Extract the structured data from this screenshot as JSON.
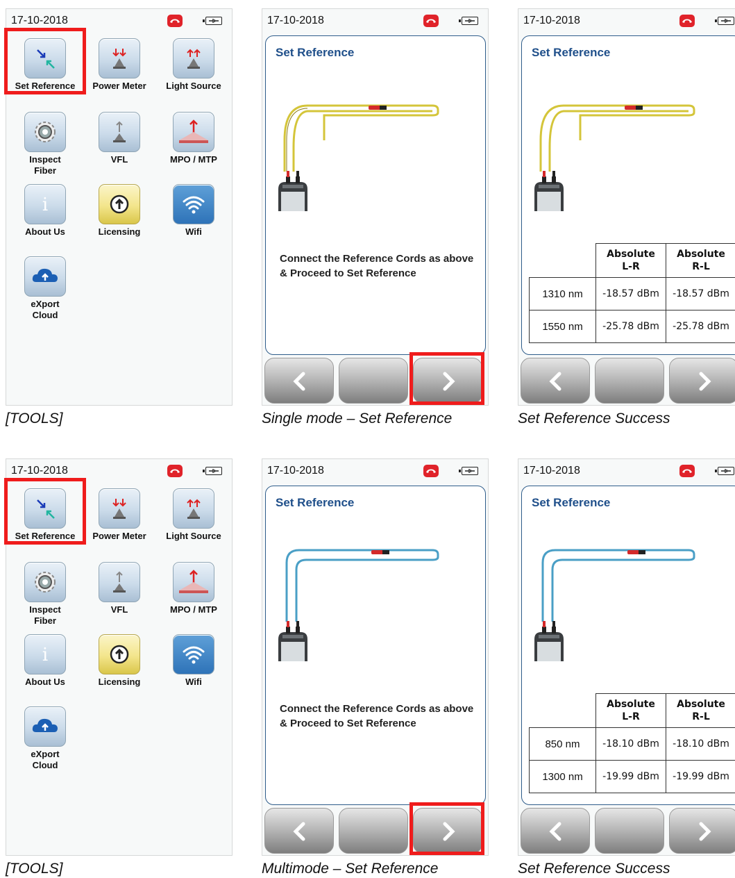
{
  "status": {
    "date": "17-10-2018"
  },
  "tools": {
    "tiles": [
      {
        "label": "Set Reference",
        "icon": "set-reference-icon"
      },
      {
        "label": "Power Meter",
        "icon": "power-meter-icon"
      },
      {
        "label": "Light Source",
        "icon": "light-source-icon"
      },
      {
        "label": "Inspect\nFiber",
        "icon": "inspect-fiber-icon"
      },
      {
        "label": "VFL",
        "icon": "vfl-icon"
      },
      {
        "label": "MPO / MTP",
        "icon": "mpo-mtp-icon"
      },
      {
        "label": "About Us",
        "icon": "info-icon"
      },
      {
        "label": "Licensing",
        "icon": "licensing-icon"
      },
      {
        "label": "Wifi",
        "icon": "wifi-icon"
      },
      {
        "label": "eXport\nCloud",
        "icon": "cloud-upload-icon"
      }
    ]
  },
  "set_reference": {
    "title": "Set Reference",
    "instruction": "Connect the Reference Cords as above & Proceed to Set Reference",
    "header_left": "Absolute\nL-R",
    "header_right": "Absolute\nR-L"
  },
  "single_mode": {
    "cord_color": "#d4c53a",
    "rows": [
      {
        "wavelength": "1310 nm",
        "lr": "-18.57 dBm",
        "rl": "-18.57 dBm"
      },
      {
        "wavelength": "1550 nm",
        "lr": "-25.78 dBm",
        "rl": "-25.78 dBm"
      }
    ]
  },
  "multimode": {
    "cord_color": "#4a9fc6",
    "rows": [
      {
        "wavelength": "850 nm",
        "lr": "-18.10 dBm",
        "rl": "-18.10 dBm"
      },
      {
        "wavelength": "1300 nm",
        "lr": "-19.99 dBm",
        "rl": "-19.99 dBm"
      }
    ]
  },
  "captions": {
    "tools": "[TOOLS]",
    "single": "Single mode – Set Reference",
    "success": "Set Reference Success",
    "multi": "Multimode – Set Reference"
  },
  "colors": {
    "highlight": "#ef1c1c",
    "title_blue": "#1f4f8a",
    "alert_red": "#e0232a"
  }
}
